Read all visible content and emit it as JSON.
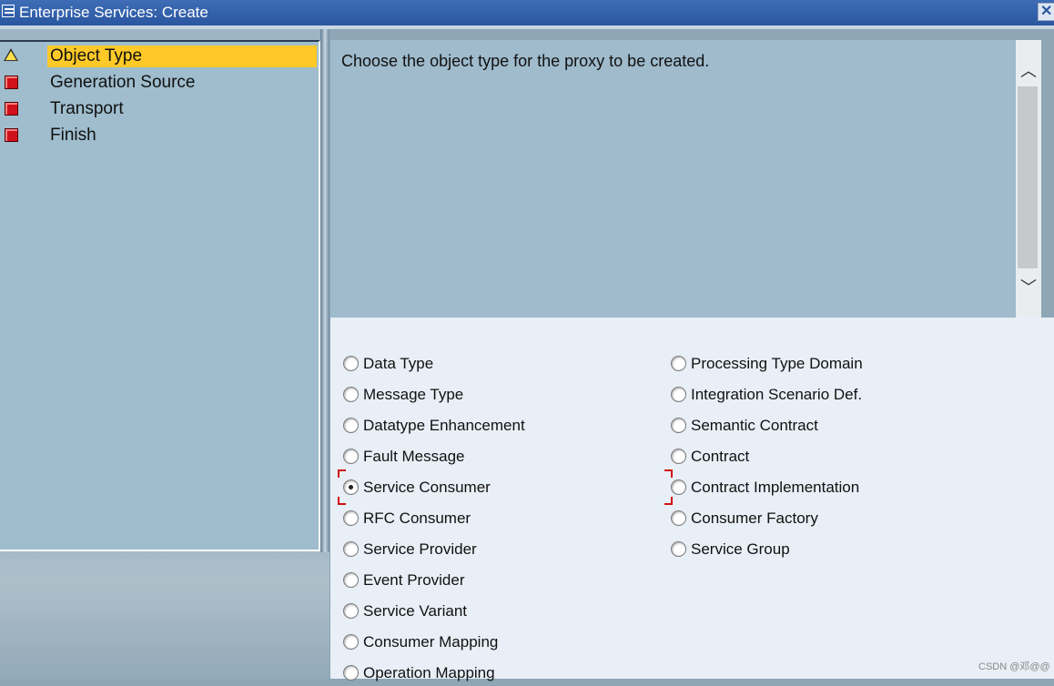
{
  "window": {
    "title": "Enterprise Services: Create"
  },
  "roadmap": [
    {
      "label": "Object Type",
      "status": "warning",
      "active": true
    },
    {
      "label": "Generation Source",
      "status": "error",
      "active": false
    },
    {
      "label": "Transport",
      "status": "error",
      "active": false
    },
    {
      "label": "Finish",
      "status": "error",
      "active": false
    }
  ],
  "description": "Choose the object type for the proxy to be created.",
  "options_left": [
    {
      "label": "Data Type",
      "selected": false
    },
    {
      "label": "Message Type",
      "selected": false
    },
    {
      "label": "Datatype Enhancement",
      "selected": false
    },
    {
      "label": "Fault Message",
      "selected": false
    },
    {
      "label": "Service Consumer",
      "selected": true
    },
    {
      "label": "RFC Consumer",
      "selected": false
    },
    {
      "label": "Service Provider",
      "selected": false
    },
    {
      "label": "Event Provider",
      "selected": false
    },
    {
      "label": "Service Variant",
      "selected": false
    },
    {
      "label": "Consumer Mapping",
      "selected": false
    },
    {
      "label": "Operation Mapping",
      "selected": false
    }
  ],
  "options_right": [
    {
      "label": "Processing Type Domain",
      "selected": false
    },
    {
      "label": "Integration Scenario Def.",
      "selected": false
    },
    {
      "label": "Semantic Contract",
      "selected": false
    },
    {
      "label": "Contract",
      "selected": false
    },
    {
      "label": "Contract Implementation",
      "selected": false
    },
    {
      "label": "Consumer Factory",
      "selected": false
    },
    {
      "label": "Service Group",
      "selected": false
    }
  ],
  "watermark": "CSDN @邓@@",
  "colors": {
    "active_step": "#ffc928",
    "titlebar": "#2a56a0"
  }
}
